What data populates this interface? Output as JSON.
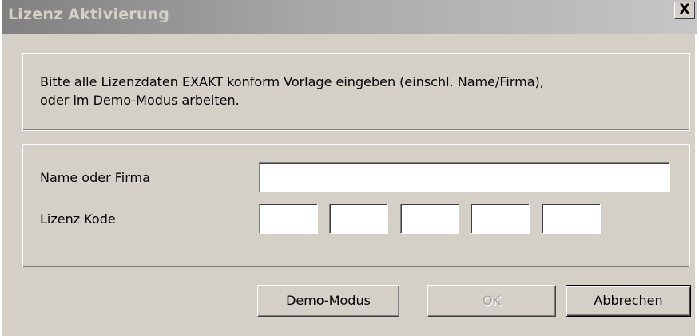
{
  "window": {
    "title": "Lizenz Aktivierung",
    "close_glyph": "X"
  },
  "info": {
    "text": "Bitte alle Lizenzdaten EXAKT konform Vorlage eingeben (einschl. Name/Firma),\noder im Demo-Modus arbeiten."
  },
  "form": {
    "name_label": "Name oder Firma",
    "name_value": "",
    "code_label": "Lizenz Kode",
    "code_values": [
      "",
      "",
      "",
      "",
      ""
    ]
  },
  "buttons": {
    "demo_label": "Demo-Modus",
    "ok_label": "OK",
    "ok_enabled": false,
    "cancel_label": "Abbrechen"
  },
  "colors": {
    "dialog_face": "#d4d0c8",
    "titlebar_start": "#808080",
    "titlebar_end": "#c6c6c6",
    "title_text": "#d4d0c8",
    "disabled_text": "#a0a0a0"
  }
}
